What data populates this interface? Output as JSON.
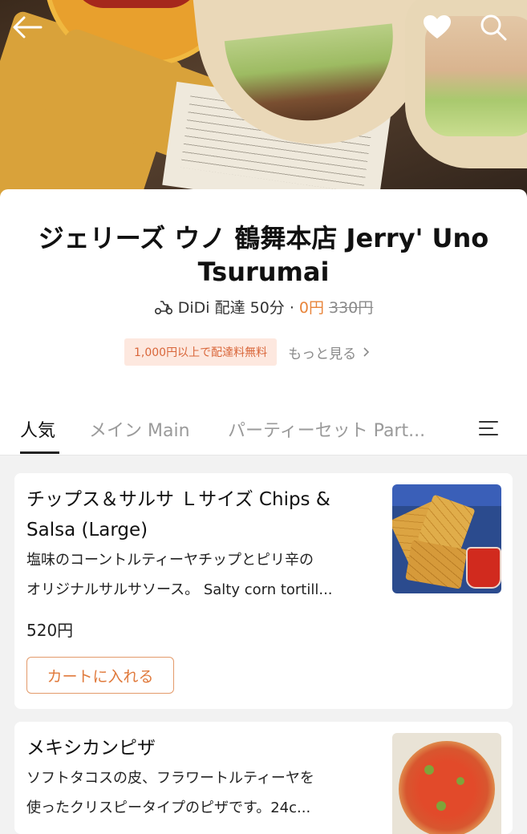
{
  "header": {
    "back_icon": "arrow-left-icon",
    "favorite_icon": "heart-icon",
    "search_icon": "search-icon"
  },
  "store": {
    "name": "ジェリーズ ウノ 鶴舞本店 Jerry' Uno Tsurumai",
    "delivery_label": "DiDi 配達 50分 ·",
    "fee_now": "0円",
    "fee_old": "330円",
    "promo": "1,000円以上で配達料無料",
    "more_label": "もっと見る"
  },
  "tabs": [
    {
      "label": "人気"
    },
    {
      "label": "メイン Main"
    },
    {
      "label": "パーティーセット Part..."
    }
  ],
  "items": [
    {
      "title": "チップス＆サルサ Ｌサイズ Chips & Salsa (Large)",
      "desc_line1": "塩味のコーントルティーヤチップとピリ辛の",
      "desc_line2": "オリジナルサルサソース。 Salty corn tortill...",
      "price": "520円",
      "cart_label": "カートに入れる"
    },
    {
      "title": "メキシカンピザ",
      "desc_line1": "ソフトタコスの皮、フラワートルティーヤを",
      "desc_line2": "使ったクリスピータイプのピザです。24c..."
    }
  ],
  "colors": {
    "accent": "#e8843a",
    "promo_bg": "#fde8df",
    "promo_text": "#d9663a"
  }
}
